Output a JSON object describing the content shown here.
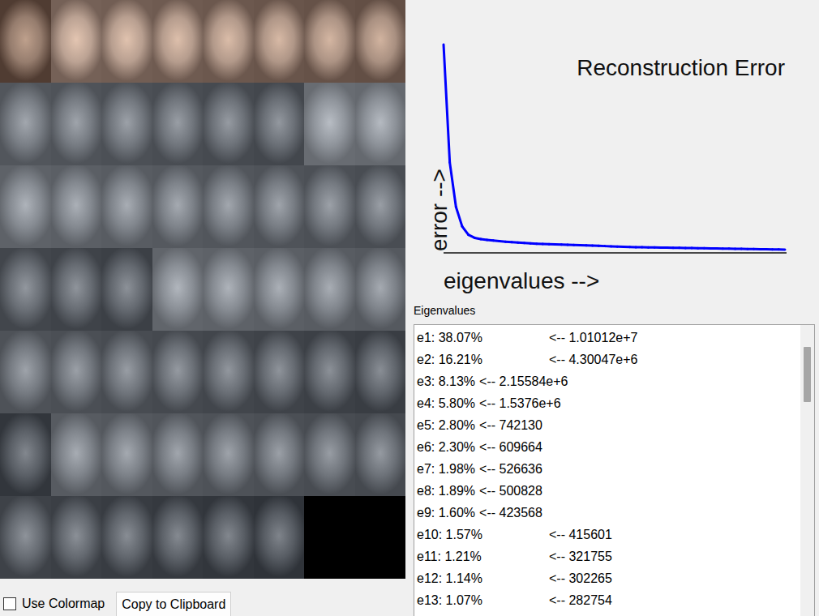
{
  "eigenfaces": [
    {
      "kind": "face"
    },
    {
      "kind": "face"
    },
    {
      "kind": "face"
    },
    {
      "kind": "face"
    },
    {
      "kind": "face"
    },
    {
      "kind": "face"
    },
    {
      "kind": "face"
    },
    {
      "kind": "face"
    },
    {
      "kind": "face"
    },
    {
      "kind": "face"
    },
    {
      "kind": "face"
    },
    {
      "kind": "face"
    },
    {
      "kind": "face"
    },
    {
      "kind": "face"
    },
    {
      "kind": "face"
    },
    {
      "kind": "face"
    },
    {
      "kind": "face"
    },
    {
      "kind": "face"
    },
    {
      "kind": "face"
    },
    {
      "kind": "face"
    },
    {
      "kind": "face"
    },
    {
      "kind": "face"
    },
    {
      "kind": "face"
    },
    {
      "kind": "face"
    },
    {
      "kind": "face"
    },
    {
      "kind": "face"
    },
    {
      "kind": "face"
    },
    {
      "kind": "face"
    },
    {
      "kind": "face"
    },
    {
      "kind": "face"
    },
    {
      "kind": "face"
    },
    {
      "kind": "face"
    },
    {
      "kind": "face"
    },
    {
      "kind": "face"
    },
    {
      "kind": "face"
    },
    {
      "kind": "face"
    },
    {
      "kind": "face"
    },
    {
      "kind": "face"
    },
    {
      "kind": "face"
    },
    {
      "kind": "face"
    },
    {
      "kind": "face"
    },
    {
      "kind": "face"
    },
    {
      "kind": "face"
    },
    {
      "kind": "face"
    },
    {
      "kind": "face"
    },
    {
      "kind": "face"
    },
    {
      "kind": "face"
    },
    {
      "kind": "face"
    },
    {
      "kind": "face"
    },
    {
      "kind": "face"
    },
    {
      "kind": "face"
    },
    {
      "kind": "face"
    },
    {
      "kind": "face"
    },
    {
      "kind": "face"
    },
    {
      "kind": "blank"
    }
  ],
  "controls": {
    "use_colormap": {
      "label": "Use Colormap",
      "checked": false
    },
    "copy_button": {
      "label": "Copy to Clipboard"
    }
  },
  "chart": {
    "title": "Reconstruction Error",
    "y_axis_label": "error -->",
    "x_axis_label": "eigenvalues -->",
    "series": [
      {
        "values": [
          100,
          43,
          21.5,
          12,
          8,
          6.5,
          5.9,
          5.5,
          5.2,
          4.9,
          4.6,
          4.4,
          4.2,
          4.0,
          3.8,
          3.6,
          3.5,
          3.4,
          3.3,
          3.2,
          3.1,
          3.0,
          2.9,
          2.8,
          2.7,
          2.6,
          2.5,
          2.4,
          2.3,
          2.2,
          2.1,
          2.0,
          1.95,
          1.9,
          1.85,
          1.8,
          1.75,
          1.7,
          1.65,
          1.6,
          1.55,
          1.5,
          1.45,
          1.4,
          1.35,
          1.3,
          1.25,
          1.2,
          1.15,
          1.1,
          1.05,
          1.0,
          0.95,
          0.9,
          0.85,
          0.8
        ]
      }
    ]
  },
  "eigenvalues": {
    "label": "Eigenvalues",
    "scrollbar": {
      "level": 0.19
    },
    "items": [
      {
        "label": "e1: 38.07%",
        "value": "<-- 1.01012e+7",
        "kind": "tabbed"
      },
      {
        "label": "e2: 16.21%",
        "value": "<-- 4.30047e+6",
        "kind": "tabbed"
      },
      {
        "label": "e3: 8.13%",
        "value": "<-- 2.15584e+6",
        "kind": "spaced"
      },
      {
        "label": "e4: 5.80%",
        "value": "<-- 1.5376e+6",
        "kind": "spaced"
      },
      {
        "label": "e5: 2.80%",
        "value": "<-- 742130",
        "kind": "spaced"
      },
      {
        "label": "e6: 2.30%",
        "value": "<-- 609664",
        "kind": "spaced"
      },
      {
        "label": "e7: 1.98%",
        "value": "<-- 526636",
        "kind": "spaced"
      },
      {
        "label": "e8: 1.89%",
        "value": "<-- 500828",
        "kind": "spaced"
      },
      {
        "label": "e9: 1.60%",
        "value": "<-- 423568",
        "kind": "spaced"
      },
      {
        "label": "e10: 1.57%",
        "value": "<-- 415601",
        "kind": "tabbed"
      },
      {
        "label": "e11: 1.21%",
        "value": "<-- 321755",
        "kind": "tabbed"
      },
      {
        "label": "e12: 1.14%",
        "value": "<-- 302265",
        "kind": "tabbed"
      },
      {
        "label": "e13: 1.07%",
        "value": "<-- 282754",
        "kind": "tabbed"
      }
    ]
  }
}
